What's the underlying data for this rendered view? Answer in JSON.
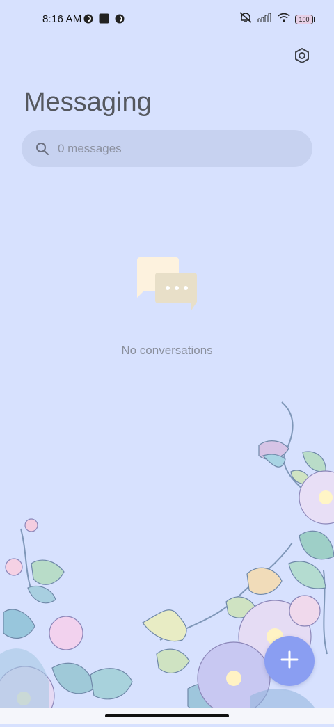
{
  "status_bar": {
    "time": "8:16 AM",
    "left_icons": [
      "app-notification-icon",
      "square-notification-icon",
      "app-notification-icon"
    ],
    "right_icons": [
      "silent-mode-icon",
      "signal-icon",
      "wifi-icon"
    ],
    "battery_level": "100"
  },
  "header": {
    "title": "Messaging",
    "settings_icon": "settings-hexagon-icon"
  },
  "search": {
    "placeholder": "0 messages"
  },
  "empty_state": {
    "message": "No conversations",
    "icon": "chat-bubbles-icon"
  },
  "fab": {
    "icon": "plus-icon"
  },
  "colors": {
    "background": "#d7e1fe",
    "search_bg": "#c7d2f0",
    "fab": "#8a9ef2",
    "title": "#55585f"
  }
}
